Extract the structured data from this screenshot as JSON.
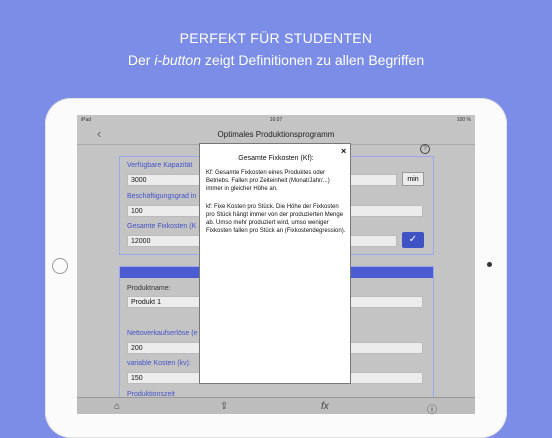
{
  "header": {
    "line1": "PERFEKT FÜR STUDENTEN",
    "line2_prefix": "Der ",
    "line2_em": "i-button",
    "line2_suffix": " zeigt Definitionen zu allen Begriffen"
  },
  "status_bar": {
    "device": "iPad",
    "time": "16:07",
    "battery": "100 %"
  },
  "nav": {
    "back_glyph": "‹",
    "title": "Optimales Produktionsprogramm"
  },
  "section1": {
    "capacity_label": "Verfügbare Kapazität",
    "capacity_value": "3000",
    "unit_button": "min",
    "utilization_label": "Beschäftigungsgrad in",
    "utilization_value": "100",
    "fixed_costs_label": "Gesamte Fixkosten (K",
    "fixed_costs_value": "12000",
    "confirm_glyph": "✓"
  },
  "section2": {
    "product_label": "Produktname:",
    "product_value": "Produkt 1",
    "price_label": "Nettoverkaufserlöse (e",
    "price_value": "200",
    "var_costs_label": "variable Kosten (kv):",
    "var_costs_value": "150",
    "next_label": "Produktionszeit"
  },
  "dialog": {
    "close_glyph": "×",
    "title": "Gesamte Fixkosten (Kf):",
    "para1": "Kf: Gesamte Fixkosten eines Produktes oder Betriebs. Fallen pro Zeiteinheit (Monat/Jahr/...) immer in gleicher Höhe an.",
    "para2": "kf: Fixe Kosten pro Stück. Die Höhe der Fixkosten pro Stück hängt immer von der produzierten Menge ab. Umso mehr produziert wird, umso weniger Fixkosten fallen pro Stück an (Fixkostendegression)."
  },
  "tabbar": {
    "formula_label": "fx"
  },
  "icons": [
    "home-icon",
    "share-icon",
    "formula-icon",
    "info-icon",
    "help-icon",
    "close-icon",
    "checkmark-icon"
  ]
}
